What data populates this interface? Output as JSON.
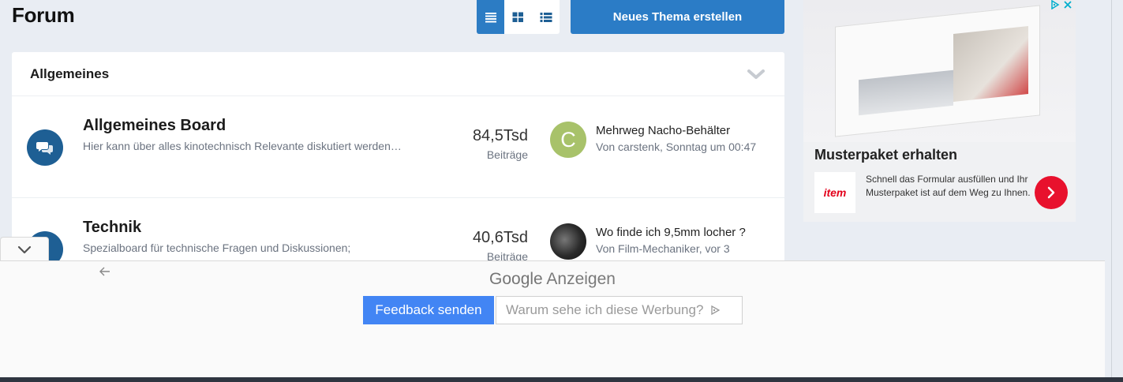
{
  "header": {
    "title": "Forum",
    "new_topic_label": "Neues Thema erstellen",
    "view_modes": [
      "list-compact-icon",
      "grid-icon",
      "list-detailed-icon"
    ]
  },
  "category": {
    "title": "Allgemeines",
    "boards": [
      {
        "title": "Allgemeines Board",
        "description": "Hier kann über alles kinotechnisch Relevante diskutiert werden…",
        "count": "84,5Tsd",
        "count_label": "Beiträge",
        "last_title": "Mehrweg Nacho-Behälter",
        "last_meta": "Von carstenk, Sonntag um 00:47",
        "avatar_letter": "C",
        "avatar_color": "#a8c26a"
      },
      {
        "title": "Technik",
        "description": "Spezialboard für technische Fragen und Diskussionen;",
        "count": "40,6Tsd",
        "count_label": "Beiträge",
        "last_title": "Wo finde ich 9,5mm locher ?",
        "last_meta": "Von Film-Mechaniker, vor 3",
        "avatar_letter": "",
        "avatar_color": "#3a3a3a"
      }
    ]
  },
  "ad": {
    "headline": "Musterpaket erhalten",
    "logo_text": "item",
    "body": "Schnell das Formular ausfüllen und Ihr Musterpaket ist auf dem Weg zu Ihnen.",
    "accent": "#e8112d"
  },
  "google_overlay": {
    "brand_google": "Google",
    "brand_suffix": "Anzeigen",
    "feedback_label": "Feedback senden",
    "why_label": "Warum sehe ich diese Werbung?"
  },
  "colors": {
    "primary": "#2b7cc6",
    "board_icon": "#1e5f94",
    "google_blue": "#4285f4"
  }
}
